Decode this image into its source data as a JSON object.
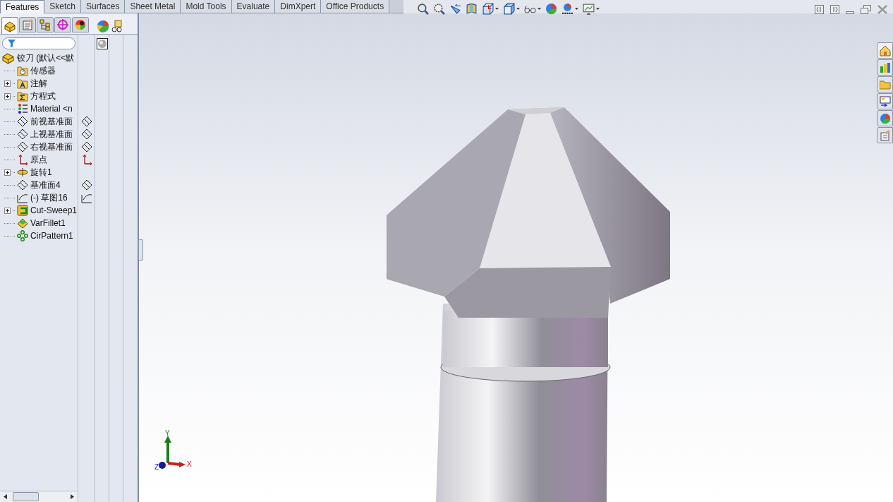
{
  "command_tabs": [
    {
      "label": "Features",
      "selected": true
    },
    {
      "label": "Sketch",
      "selected": false
    },
    {
      "label": "Surfaces",
      "selected": false
    },
    {
      "label": "Sheet Metal",
      "selected": false
    },
    {
      "label": "Mold Tools",
      "selected": false
    },
    {
      "label": "Evaluate",
      "selected": false
    },
    {
      "label": "DimXpert",
      "selected": false
    },
    {
      "label": "Office Products",
      "selected": false
    }
  ],
  "manager_tabs": [
    {
      "kind": "feature",
      "selected": true
    },
    {
      "kind": "property",
      "selected": false
    },
    {
      "kind": "config",
      "selected": false
    },
    {
      "kind": "dimxpert",
      "selected": false
    },
    {
      "kind": "display",
      "selected": false
    }
  ],
  "tree": {
    "label": "铰刀 (默认<<默",
    "kind": "part",
    "children": [
      {
        "label": "传感器",
        "kind": "sensor",
        "expandable": false,
        "side_icon": false
      },
      {
        "label": "注解",
        "kind": "annotation",
        "expandable": true,
        "side_icon": false
      },
      {
        "label": "方程式",
        "kind": "equation",
        "expandable": true,
        "side_icon": false
      },
      {
        "label": "Material <n",
        "kind": "material",
        "expandable": false,
        "side_icon": false
      },
      {
        "label": "前视基准面",
        "kind": "plane",
        "expandable": false,
        "side_icon": true
      },
      {
        "label": "上视基准面",
        "kind": "plane",
        "expandable": false,
        "side_icon": true
      },
      {
        "label": "右视基准面",
        "kind": "plane",
        "expandable": false,
        "side_icon": true
      },
      {
        "label": "原点",
        "kind": "origin",
        "expandable": false,
        "side_icon": true
      },
      {
        "label": "旋转1",
        "kind": "revolve",
        "expandable": true,
        "side_icon": false
      },
      {
        "label": "基准面4",
        "kind": "plane",
        "expandable": false,
        "side_icon": true
      },
      {
        "label": "(-) 草图16",
        "kind": "sketch",
        "expandable": false,
        "side_icon": true
      },
      {
        "label": "Cut-Sweep1",
        "kind": "sweep",
        "expandable": true,
        "side_icon": false
      },
      {
        "label": "VarFillet1",
        "kind": "fillet",
        "expandable": false,
        "side_icon": false
      },
      {
        "label": "CirPattern1",
        "kind": "pattern",
        "expandable": false,
        "side_icon": false
      }
    ]
  },
  "view_toolbar": [
    {
      "kind": "zoom-fit",
      "dropdown": false
    },
    {
      "kind": "zoom-area",
      "dropdown": false
    },
    {
      "kind": "previous",
      "dropdown": false
    },
    {
      "kind": "section",
      "dropdown": false
    },
    {
      "kind": "orientation",
      "dropdown": true
    },
    {
      "kind": "display-style",
      "dropdown": true
    },
    {
      "kind": "hide-show",
      "dropdown": true
    },
    {
      "kind": "appearance",
      "dropdown": false
    },
    {
      "kind": "scene",
      "dropdown": true
    },
    {
      "kind": "settings",
      "dropdown": true
    }
  ],
  "triad": {
    "x": "X",
    "y": "Y",
    "z": "Z"
  }
}
